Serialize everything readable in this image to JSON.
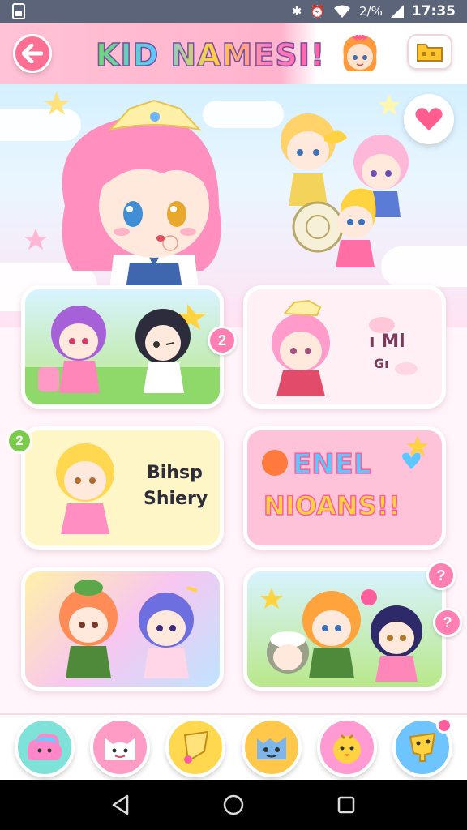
{
  "status_bar": {
    "time": "17:35",
    "icons": [
      "sim-icon",
      "bluetooth-icon",
      "alarm-icon",
      "wifi-icon",
      "signal-icon"
    ],
    "signal_text": "2/%"
  },
  "header": {
    "title": "KID NAMESI!",
    "back_icon": "arrow-left-icon",
    "folder_icon": "folder-icon"
  },
  "hero": {
    "favorite_icon": "heart-icon"
  },
  "cards": [
    {
      "id": "card-1",
      "badge": "2"
    },
    {
      "id": "card-2",
      "text_line1": "ı Ml",
      "text_line2": "Gı"
    },
    {
      "id": "card-3",
      "badge": "2",
      "text_line1": "Bihsp",
      "text_line2": "Shiery"
    },
    {
      "id": "card-4",
      "text_line1": "ENEL",
      "text_line2": "NIOANS!!"
    },
    {
      "id": "card-5"
    },
    {
      "id": "card-6",
      "badge_a": "?",
      "badge_b": "?"
    }
  ],
  "bottom_bar": {
    "buttons": [
      "blob-icon",
      "cat-face-icon",
      "star-icon",
      "monster-icon",
      "chick-icon",
      "cheese-icon"
    ]
  },
  "nav_bar": {
    "buttons": [
      "back-triangle-icon",
      "home-circle-icon",
      "recents-square-icon"
    ]
  },
  "colors": {
    "accent_pink": "#ff6f94",
    "header_pink": "#ffb3cc",
    "status_bar": "#5b6478"
  }
}
